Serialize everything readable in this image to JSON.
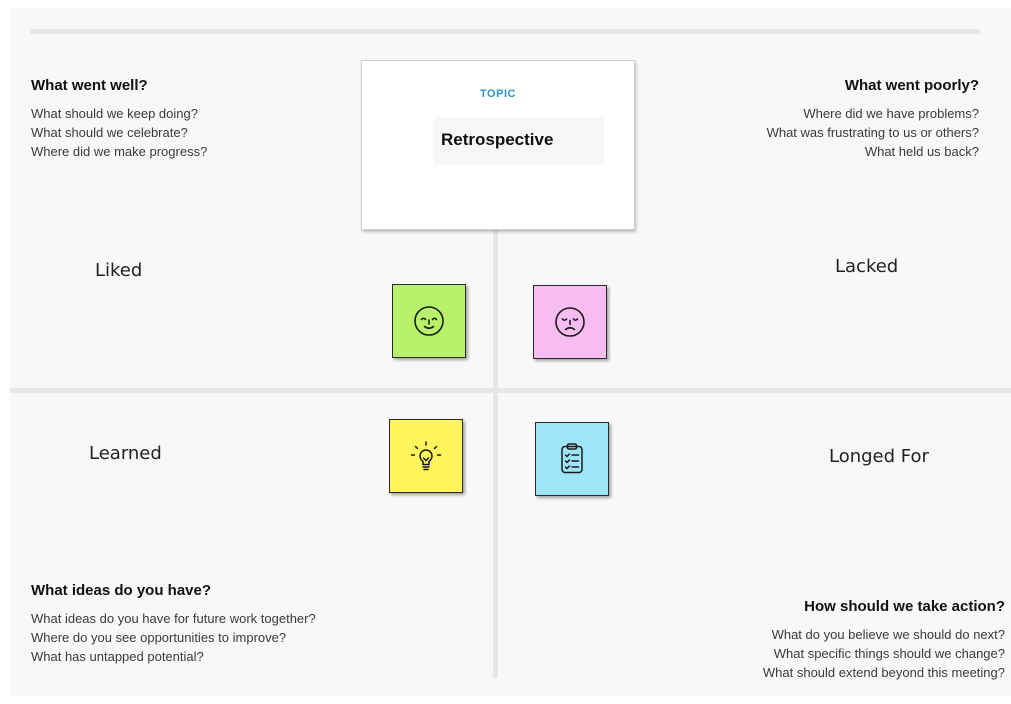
{
  "topic": {
    "label": "TOPIC",
    "title": "Retrospective"
  },
  "quadrants": {
    "top_left": {
      "heading": "What went well?",
      "questions": [
        "What should we keep doing?",
        "What should we celebrate?",
        "Where did we make progress?"
      ]
    },
    "top_right": {
      "heading": "What went poorly?",
      "questions": [
        "Where did we have problems?",
        "What was frustrating to us or others?",
        "What held us back?"
      ]
    },
    "bottom_left": {
      "heading": "What ideas do you have?",
      "questions": [
        "What ideas do you have for future work together?",
        "Where do you see opportunities to improve?",
        "What has untapped potential?"
      ]
    },
    "bottom_right": {
      "heading": "How should we take action?",
      "questions": [
        "What do you believe we should do next?",
        "What specific things should we change?",
        "What should extend beyond this meeting?"
      ]
    }
  },
  "labels": {
    "liked": "Liked",
    "lacked": "Lacked",
    "learned": "Learned",
    "longed_for": "Longed For"
  },
  "stickies": [
    {
      "name": "liked",
      "color": "#b7f26a",
      "icon": "happy-face-icon"
    },
    {
      "name": "lacked",
      "color": "#f8bdf0",
      "icon": "sad-face-icon"
    },
    {
      "name": "learned",
      "color": "#fff45b",
      "icon": "lightbulb-icon"
    },
    {
      "name": "longed_for",
      "color": "#9fe5f9",
      "icon": "clipboard-checklist-icon"
    }
  ]
}
